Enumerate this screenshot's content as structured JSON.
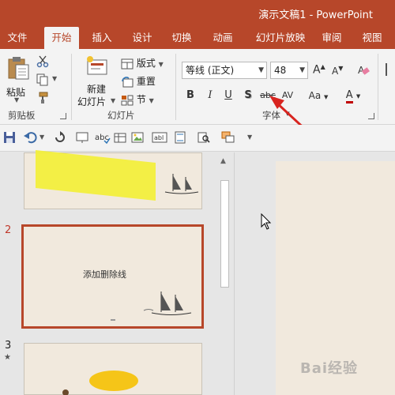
{
  "window": {
    "title": "演示文稿1  -  PowerPoint"
  },
  "tabs": [
    "文件",
    "开始",
    "插入",
    "设计",
    "切换",
    "动画",
    "幻灯片放映",
    "审阅",
    "视图"
  ],
  "active_tab": "开始",
  "ribbon": {
    "clipboard": {
      "paste_label": "粘贴",
      "group_label": "剪贴板"
    },
    "slides": {
      "new_slide_label_1": "新建",
      "new_slide_label_2": "幻灯片",
      "layout_label": "版式",
      "reset_label": "重置",
      "section_label": "节",
      "group_label": "幻灯片"
    },
    "font": {
      "font_name": "等线 (正文)",
      "font_size": "48",
      "bold": "B",
      "italic": "I",
      "underline": "U",
      "shadow": "S",
      "strikethrough": "abc",
      "spacing": "AV",
      "case": "Aa",
      "color": "A",
      "group_label": "字体"
    }
  },
  "thumbnails": {
    "slide2": {
      "number": "2",
      "text": "添加删除线"
    },
    "slide3": {
      "number": "3",
      "star": "★"
    }
  },
  "colors": {
    "accent": "#b7472a",
    "slide_bg": "#f1e9dd",
    "arrow": "#d8241f"
  },
  "watermark": "Bai经验"
}
